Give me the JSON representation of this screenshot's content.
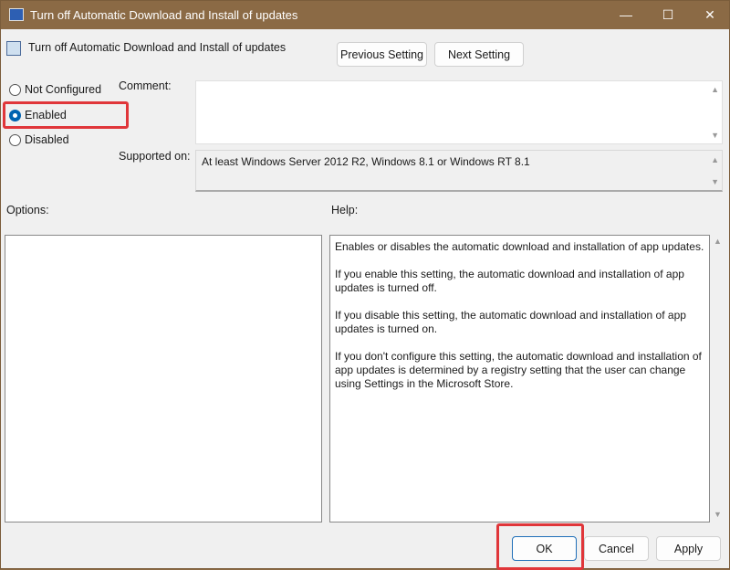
{
  "window": {
    "title": "Turn off Automatic Download and Install of updates",
    "controls": [
      "—",
      "☐",
      "✕"
    ]
  },
  "header": {
    "title": "Turn off Automatic Download and Install of updates",
    "previous_label": "Previous Setting",
    "next_label": "Next Setting"
  },
  "state": {
    "options": [
      "Not Configured",
      "Enabled",
      "Disabled"
    ],
    "selected": "Enabled"
  },
  "comment_label": "Comment:",
  "comment_value": "",
  "supported_label": "Supported on:",
  "supported_value": "At least Windows Server 2012 R2, Windows 8.1 or Windows RT 8.1",
  "options_label": "Options:",
  "help_label": "Help:",
  "help": [
    "Enables or disables the automatic download and installation of app updates.",
    "If you enable this setting, the automatic download and installation of app updates is turned off.",
    "If you disable this setting, the automatic download and installation of app updates is turned on.",
    "If you don't configure this setting, the automatic download and installation of app updates is determined by a registry setting that the user can change using Settings in the Microsoft Store."
  ],
  "footer": {
    "ok": "OK",
    "cancel": "Cancel",
    "apply": "Apply"
  },
  "colors": {
    "titlebar": "#8b6a45",
    "highlight": "#e0363a",
    "accent": "#0063b1"
  }
}
